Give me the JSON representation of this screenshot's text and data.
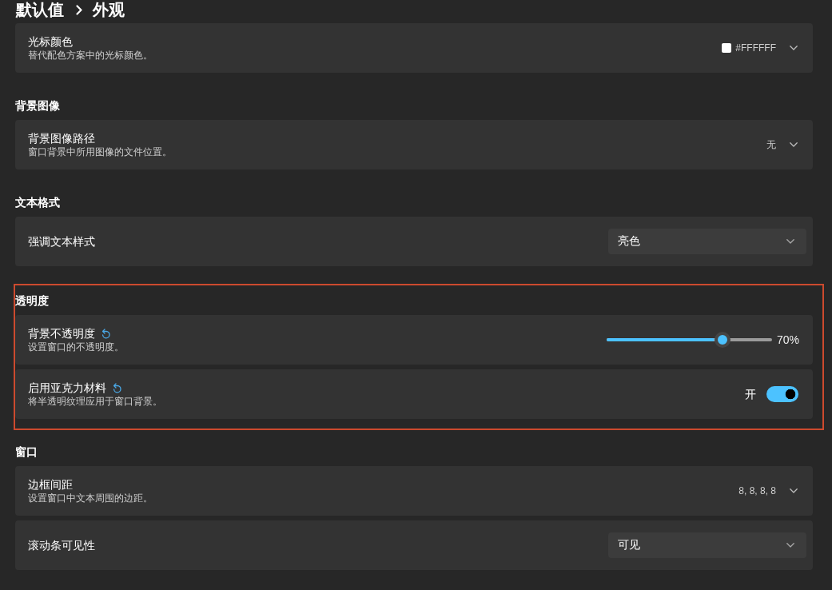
{
  "breadcrumb": [
    {
      "label": "默认值"
    },
    {
      "label": "外观"
    }
  ],
  "sections": [
    {
      "highlighted": false,
      "items": [
        {
          "kind": "color",
          "title": "光标颜色",
          "description": "替代配色方案中的光标颜色。",
          "modified": false,
          "color": "#ffffff",
          "value": "#FFFFFF"
        }
      ]
    },
    {
      "title": "背景图像",
      "highlighted": false,
      "items": [
        {
          "kind": "value",
          "title": "背景图像路径",
          "description": "窗口背景中所用图像的文件位置。",
          "modified": false,
          "value": "无"
        }
      ]
    },
    {
      "title": "文本格式",
      "highlighted": false,
      "items": [
        {
          "kind": "combo",
          "title": "强调文本样式",
          "modified": false,
          "value": "亮色"
        }
      ]
    },
    {
      "title": "透明度",
      "highlighted": true,
      "items": [
        {
          "kind": "slider",
          "title": "背景不透明度",
          "description": "设置窗口的不透明度。",
          "modified": true,
          "level": 0.7,
          "reading": "70%"
        },
        {
          "kind": "toggle",
          "title": "启用亚克力材料",
          "description": "将半透明纹理应用于窗口背景。",
          "modified": true,
          "on": true,
          "state_label": "开"
        }
      ]
    },
    {
      "title": "窗口",
      "highlighted": false,
      "items": [
        {
          "kind": "value",
          "title": "边框间距",
          "description": "设置窗口中文本周围的边距。",
          "modified": false,
          "value": "8, 8, 8, 8"
        },
        {
          "kind": "combo",
          "title": "滚动条可见性",
          "modified": false,
          "value": "可见"
        }
      ]
    }
  ]
}
